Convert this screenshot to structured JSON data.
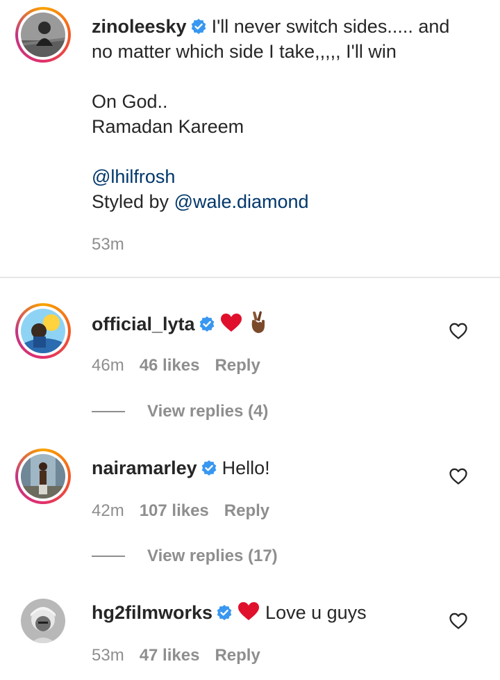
{
  "caption": {
    "username": "zinoleesky",
    "text_line1": "I'll never switch sides..... and",
    "text_line2": "no matter which side I take,,,,, I'll win",
    "text_line3": "On God..",
    "text_line4": "Ramadan Kareem",
    "mention1": "@lhilfrosh",
    "styled_prefix": "Styled by ",
    "mention2": "@wale.diamond",
    "time": "53m"
  },
  "comments": [
    {
      "username": "official_lyta",
      "time": "46m",
      "likes": "46 likes",
      "reply": "Reply",
      "view_replies": "View replies (4)",
      "emojis": [
        "red-heart",
        "crossed-fingers-dark-skin"
      ]
    },
    {
      "username": "nairamarley",
      "text": "Hello!",
      "time": "42m",
      "likes": "107 likes",
      "reply": "Reply",
      "view_replies": "View replies (17)"
    },
    {
      "username": "hg2filmworks",
      "text": "Love u guys",
      "time": "53m",
      "likes": "47 likes",
      "reply": "Reply",
      "emojis": [
        "red-heart"
      ]
    }
  ],
  "colors": {
    "verified": "#3897f0",
    "mention": "#00376b",
    "meta": "#8e8e8e",
    "heart_emoji": "#e0102c"
  }
}
